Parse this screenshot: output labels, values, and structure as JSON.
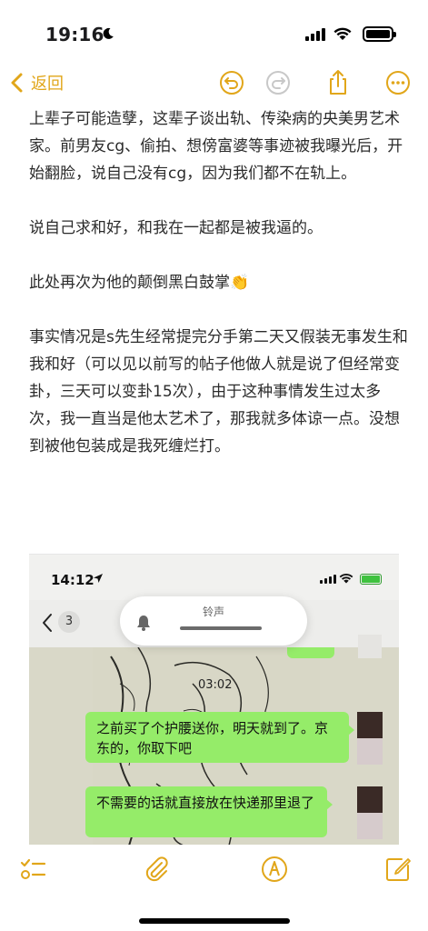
{
  "status_bar": {
    "time": "19:16",
    "focus_icon": "moon-icon",
    "cellular_icon": "cellular-signal-icon",
    "wifi_icon": "wifi-icon",
    "battery_icon": "battery-icon"
  },
  "nav": {
    "back_label": "返回",
    "accent_color": "#e1a61a",
    "icons": [
      "undo-icon",
      "redo-icon",
      "share-icon",
      "more-icon"
    ]
  },
  "note": {
    "paragraphs": [
      "上辈子可能造孽，这辈子谈出轨、传染病的央美男艺术家。前男友cg、偷拍、想傍富婆等事迹被我曝光后，开始翻脸，说自己没有cg，因为我们都不在轨上。",
      "说自己求和好，和我在一起都是被我逼的。",
      "此处再次为他的颠倒黑白鼓掌👏",
      "事实情况是s先生经常提完分手第二天又假装无事发生和我和好（可以见以前写的帖子他做人就是说了但经常变卦，三天可以变卦15次），由于这种事情发生过太多次，我一直当是他太艺术了，那我就多体谅一点。没想到被他包装成是我死缠烂打。"
    ]
  },
  "embedded_screenshot": {
    "time": "14:12",
    "unread_badge": "3",
    "ringer_label": "铃声",
    "voice_duration": "03:02",
    "bubble_color": "#95ec69",
    "messages": [
      "之前买了个护腰送你，明天就到了。京东的，你取下吧",
      "不需要的话就直接放在快递那里退了"
    ]
  },
  "bottom_bar": {
    "icons": [
      "checklist-icon",
      "attachment-icon",
      "markup-icon",
      "compose-icon"
    ]
  }
}
